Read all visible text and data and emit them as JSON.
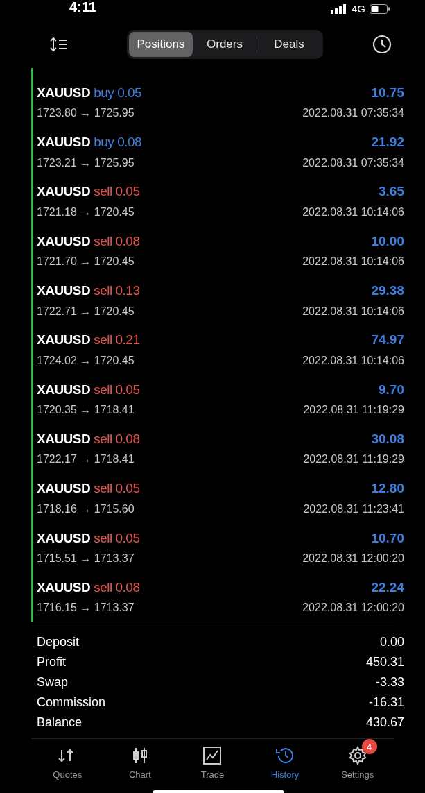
{
  "status_bar": {
    "time": "4:11",
    "network": "4G"
  },
  "segments": [
    {
      "label": "Positions",
      "selected": true
    },
    {
      "label": "Orders",
      "selected": false
    },
    {
      "label": "Deals",
      "selected": false
    }
  ],
  "deals": [
    {
      "symbol": "XAUUSD",
      "side": "buy",
      "volume": "0.05",
      "prices": "1723.80 → 1725.95",
      "profit": "10.75",
      "time": "2022.08.31 07:35:34"
    },
    {
      "symbol": "XAUUSD",
      "side": "buy",
      "volume": "0.08",
      "prices": "1723.21 → 1725.95",
      "profit": "21.92",
      "time": "2022.08.31 07:35:34"
    },
    {
      "symbol": "XAUUSD",
      "side": "sell",
      "volume": "0.05",
      "prices": "1721.18 → 1720.45",
      "profit": "3.65",
      "time": "2022.08.31 10:14:06"
    },
    {
      "symbol": "XAUUSD",
      "side": "sell",
      "volume": "0.08",
      "prices": "1721.70 → 1720.45",
      "profit": "10.00",
      "time": "2022.08.31 10:14:06"
    },
    {
      "symbol": "XAUUSD",
      "side": "sell",
      "volume": "0.13",
      "prices": "1722.71 → 1720.45",
      "profit": "29.38",
      "time": "2022.08.31 10:14:06"
    },
    {
      "symbol": "XAUUSD",
      "side": "sell",
      "volume": "0.21",
      "prices": "1724.02 → 1720.45",
      "profit": "74.97",
      "time": "2022.08.31 10:14:06"
    },
    {
      "symbol": "XAUUSD",
      "side": "sell",
      "volume": "0.05",
      "prices": "1720.35 → 1718.41",
      "profit": "9.70",
      "time": "2022.08.31 11:19:29"
    },
    {
      "symbol": "XAUUSD",
      "side": "sell",
      "volume": "0.08",
      "prices": "1722.17 → 1718.41",
      "profit": "30.08",
      "time": "2022.08.31 11:19:29"
    },
    {
      "symbol": "XAUUSD",
      "side": "sell",
      "volume": "0.05",
      "prices": "1718.16 → 1715.60",
      "profit": "12.80",
      "time": "2022.08.31 11:23:41"
    },
    {
      "symbol": "XAUUSD",
      "side": "sell",
      "volume": "0.05",
      "prices": "1715.51 → 1713.37",
      "profit": "10.70",
      "time": "2022.08.31 12:00:20"
    },
    {
      "symbol": "XAUUSD",
      "side": "sell",
      "volume": "0.08",
      "prices": "1716.15 → 1713.37",
      "profit": "22.24",
      "time": "2022.08.31 12:00:20"
    }
  ],
  "summary": [
    {
      "label": "Deposit",
      "value": "0.00"
    },
    {
      "label": "Profit",
      "value": "450.31"
    },
    {
      "label": "Swap",
      "value": "-3.33"
    },
    {
      "label": "Commission",
      "value": "-16.31"
    },
    {
      "label": "Balance",
      "value": "430.67"
    }
  ],
  "tab_bar": [
    {
      "kind": "quotes",
      "label": "Quotes",
      "selected": false
    },
    {
      "kind": "chart",
      "label": "Chart",
      "selected": false
    },
    {
      "kind": "trade",
      "label": "Trade",
      "selected": false
    },
    {
      "kind": "history",
      "label": "History",
      "selected": true
    },
    {
      "kind": "settings",
      "label": "Settings",
      "selected": false,
      "badge": "4"
    }
  ]
}
